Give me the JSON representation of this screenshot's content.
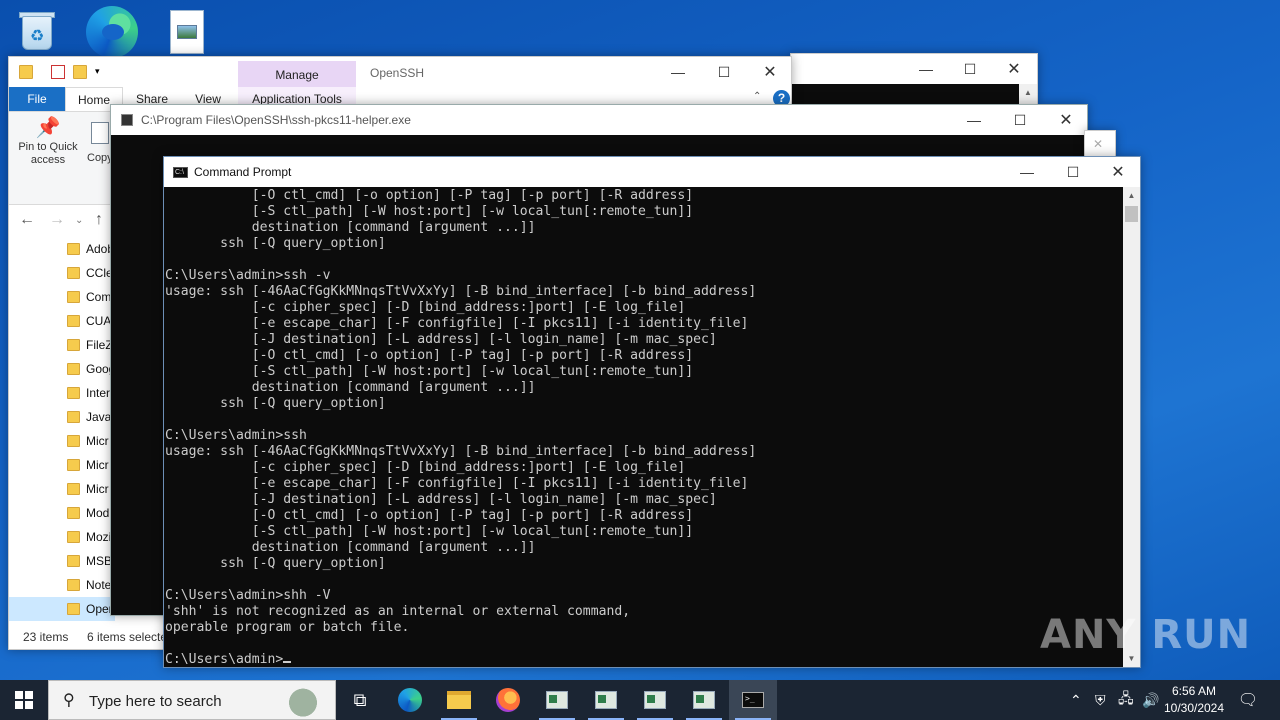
{
  "desktop": {
    "icons": [
      "recycle-bin-icon",
      "edge-icon",
      "image-file-icon"
    ]
  },
  "explorer": {
    "manage_tab": "Manage",
    "title": "OpenSSH",
    "tabs": {
      "file": "File",
      "home": "Home",
      "share": "Share",
      "view": "View",
      "app_tools": "Application Tools"
    },
    "ribbon": {
      "pin_label": "Pin to Quick access",
      "copy_label": "Copy"
    },
    "tree": [
      "Adob",
      "CCle",
      "Com",
      "CUA",
      "FileZ",
      "Goog",
      "Inter",
      "Java",
      "Micr",
      "Micr",
      "Micr",
      "Mod",
      "Mozi",
      "MSB",
      "Note",
      "Open"
    ],
    "status": {
      "items": "23 items",
      "selected": "6 items selecte"
    }
  },
  "helper_window": {
    "title": "C:\\Program Files\\OpenSSH\\ssh-pkcs11-helper.exe"
  },
  "cmd": {
    "title": "Command Prompt",
    "lines": [
      "           [-O ctl_cmd] [-o option] [-P tag] [-p port] [-R address]",
      "           [-S ctl_path] [-W host:port] [-w local_tun[:remote_tun]]",
      "           destination [command [argument ...]]",
      "       ssh [-Q query_option]",
      "",
      "C:\\Users\\admin>ssh -v",
      "usage: ssh [-46AaCfGgKkMNnqsTtVvXxYy] [-B bind_interface] [-b bind_address]",
      "           [-c cipher_spec] [-D [bind_address:]port] [-E log_file]",
      "           [-e escape_char] [-F configfile] [-I pkcs11] [-i identity_file]",
      "           [-J destination] [-L address] [-l login_name] [-m mac_spec]",
      "           [-O ctl_cmd] [-o option] [-P tag] [-p port] [-R address]",
      "           [-S ctl_path] [-W host:port] [-w local_tun[:remote_tun]]",
      "           destination [command [argument ...]]",
      "       ssh [-Q query_option]",
      "",
      "C:\\Users\\admin>ssh",
      "usage: ssh [-46AaCfGgKkMNnqsTtVvXxYy] [-B bind_interface] [-b bind_address]",
      "           [-c cipher_spec] [-D [bind_address:]port] [-E log_file]",
      "           [-e escape_char] [-F configfile] [-I pkcs11] [-i identity_file]",
      "           [-J destination] [-L address] [-l login_name] [-m mac_spec]",
      "           [-O ctl_cmd] [-o option] [-P tag] [-p port] [-R address]",
      "           [-S ctl_path] [-W host:port] [-w local_tun[:remote_tun]]",
      "           destination [command [argument ...]]",
      "       ssh [-Q query_option]",
      "",
      "C:\\Users\\admin>shh -V",
      "'shh' is not recognized as an internal or external command,",
      "operable program or batch file.",
      "",
      "C:\\Users\\admin>"
    ]
  },
  "watermark": "ANY RUN",
  "taskbar": {
    "search_placeholder": "Type here to search",
    "time": "6:56 AM",
    "date": "10/30/2024"
  }
}
